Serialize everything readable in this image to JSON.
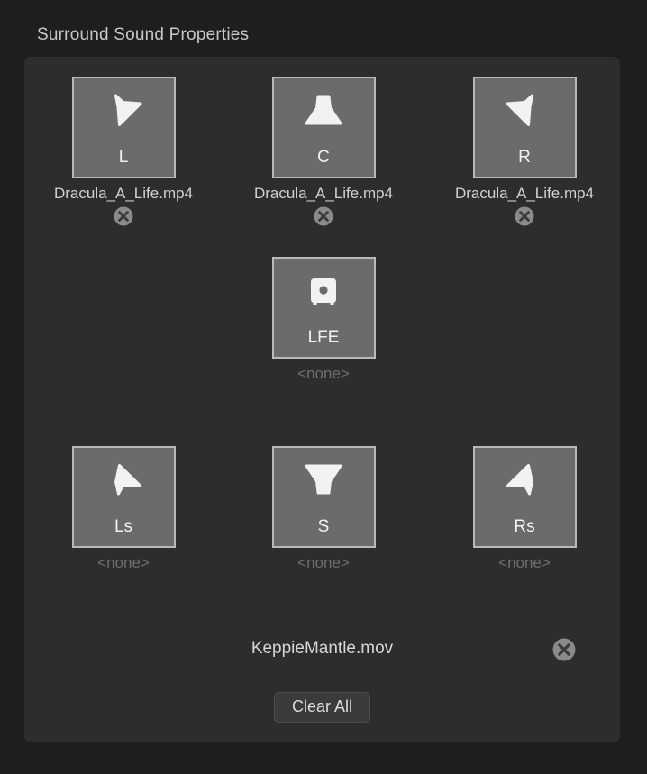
{
  "title": "Surround Sound Properties",
  "channels": [
    {
      "id": "left",
      "label": "L",
      "icon": "speaker-cone-down-right-icon",
      "filename": "Dracula_A_Life.mp4",
      "assigned": true,
      "remove_icon": "remove-circle-icon"
    },
    {
      "id": "center",
      "label": "C",
      "icon": "speaker-cone-down-icon",
      "filename": "Dracula_A_Life.mp4",
      "assigned": true,
      "remove_icon": "remove-circle-icon"
    },
    {
      "id": "right",
      "label": "R",
      "icon": "speaker-cone-down-left-icon",
      "filename": "Dracula_A_Life.mp4",
      "assigned": true,
      "remove_icon": "remove-circle-icon"
    },
    {
      "id": "lfe",
      "label": "LFE",
      "icon": "subwoofer-icon",
      "filename": "<none>",
      "assigned": false,
      "remove_icon": null
    },
    {
      "id": "left-surround",
      "label": "Ls",
      "icon": "speaker-cone-up-right-icon",
      "filename": "<none>",
      "assigned": false,
      "remove_icon": null
    },
    {
      "id": "surround",
      "label": "S",
      "icon": "speaker-cone-up-icon",
      "filename": "<none>",
      "assigned": false,
      "remove_icon": null
    },
    {
      "id": "right-surround",
      "label": "Rs",
      "icon": "speaker-cone-up-left-icon",
      "filename": "<none>",
      "assigned": false,
      "remove_icon": null
    }
  ],
  "footer": {
    "source_filename": "KeppieMantle.mov",
    "remove_icon": "remove-circle-icon",
    "clear_all_label": "Clear All"
  },
  "colors": {
    "page_background": "#1e1e1e",
    "panel_background": "#2d2d2d",
    "tile_background": "#6b6b6b",
    "tile_border": "#b9b9b9",
    "icon_fill": "#f2f2f2",
    "title_text": "#c8c8c6",
    "filename_text": "#d2d2d0",
    "empty_text": "#6e6e6e",
    "badge_circle": "#8a8a8a",
    "badge_glyph": "#3a3a3a",
    "button_background": "#3b3b3b"
  }
}
